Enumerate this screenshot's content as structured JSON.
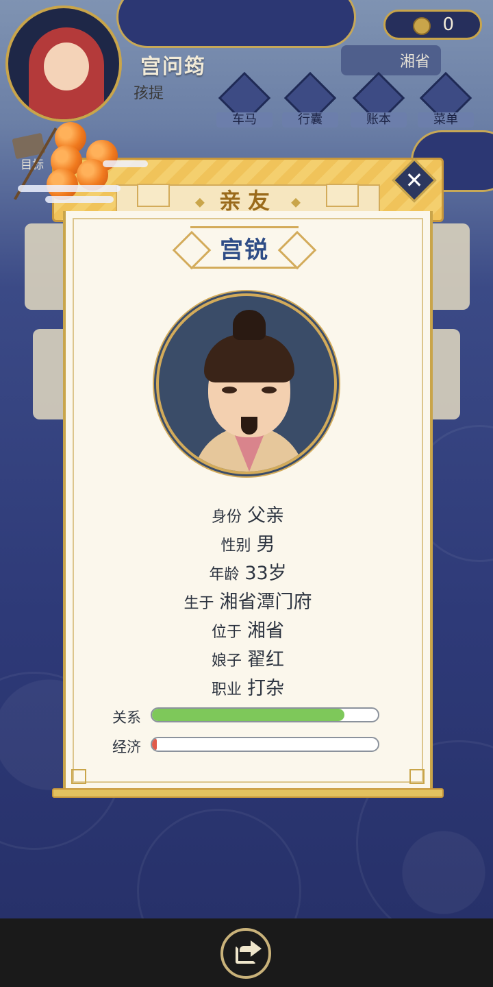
{
  "player": {
    "name": "宫问筠",
    "stage": "孩提"
  },
  "currency": {
    "icon": "coin-icon",
    "amount": "0"
  },
  "province": "湘省",
  "nav": [
    {
      "label": "车马",
      "icon": "carriage-icon"
    },
    {
      "label": "行囊",
      "icon": "bundle-icon"
    },
    {
      "label": "账本",
      "icon": "ledger-icon"
    },
    {
      "label": "菜单",
      "icon": "menu-dots-icon"
    }
  ],
  "goal_label": "目标",
  "dialog": {
    "title": "亲友",
    "close_symbol": "✕",
    "character": {
      "name": "宫锐",
      "info": [
        {
          "label": "身份",
          "value": "父亲"
        },
        {
          "label": "性别",
          "value": "男"
        },
        {
          "label": "年龄",
          "value": "33岁"
        },
        {
          "label": "生于",
          "value": "湘省潭门府"
        },
        {
          "label": "位于",
          "value": "湘省"
        },
        {
          "label": "娘子",
          "value": "翟红"
        },
        {
          "label": "职业",
          "value": "打杂"
        }
      ],
      "bars": [
        {
          "label": "关系",
          "fraction": 0.85,
          "color": "#7ec85a"
        },
        {
          "label": "经济",
          "fraction": 0.02,
          "color": "#e05a4a"
        }
      ]
    }
  },
  "colors": {
    "gold": "#c9a54a",
    "title_blue": "#2e4c86",
    "paper": "#fbf7ec"
  }
}
